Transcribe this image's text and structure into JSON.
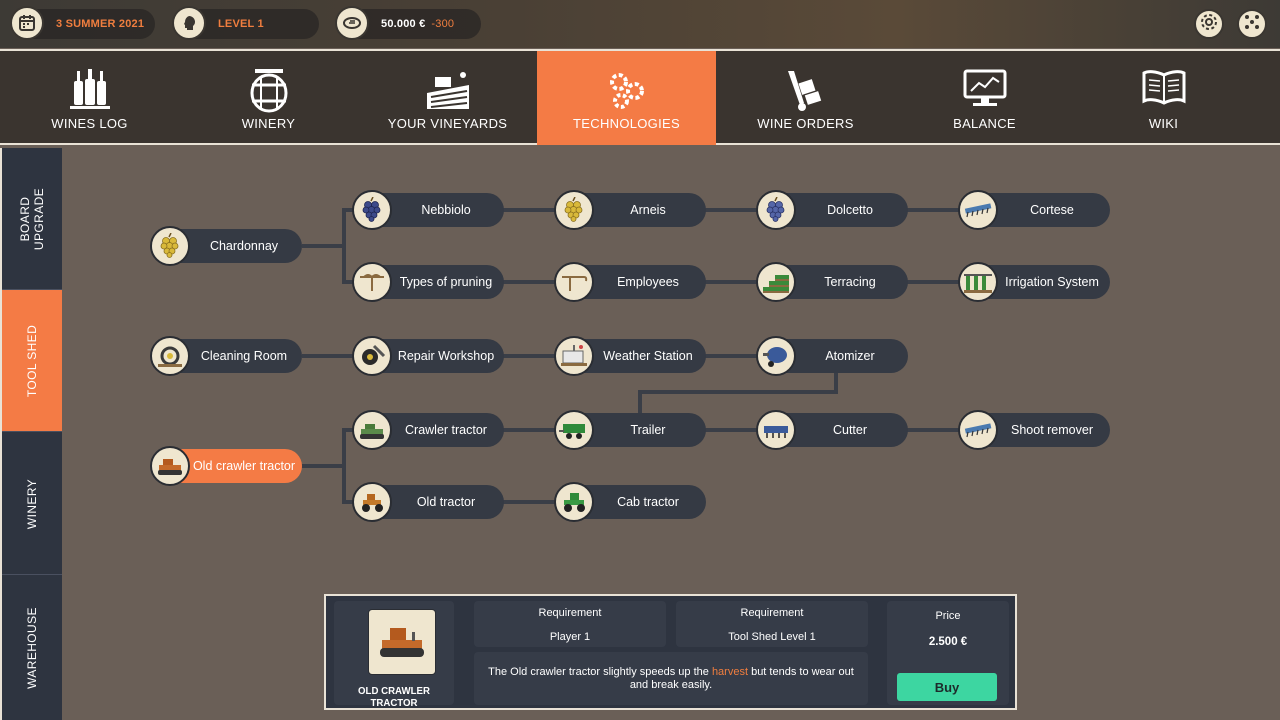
{
  "status": {
    "date": "3 SUMMER 2021",
    "level": "LEVEL 1",
    "money": "50.000 €",
    "money_delta": "-300"
  },
  "nav": [
    {
      "label": "WINES LOG",
      "icon": "wine-bottles-icon"
    },
    {
      "label": "WINERY",
      "icon": "barrel-icon"
    },
    {
      "label": "YOUR VINEYARDS",
      "icon": "vineyard-icon"
    },
    {
      "label": "TECHNOLOGIES",
      "icon": "gears-icon",
      "active": true
    },
    {
      "label": "WINE ORDERS",
      "icon": "hand-truck-icon"
    },
    {
      "label": "BALANCE",
      "icon": "monitor-chart-icon"
    },
    {
      "label": "WIKI",
      "icon": "book-icon"
    }
  ],
  "side_tabs": [
    {
      "label": "BOARD UPGRADE"
    },
    {
      "label": "TOOL SHED",
      "active": true
    },
    {
      "label": "WINERY"
    },
    {
      "label": "WAREHOUSE"
    }
  ],
  "tree": {
    "chardonnay": "Chardonnay",
    "nebbiolo": "Nebbiolo",
    "arneis": "Arneis",
    "dolcetto": "Dolcetto",
    "cortese": "Cortese",
    "pruning": "Types of pruning",
    "employees": "Employees",
    "terracing": "Terracing",
    "irrigation": "Irrigation System",
    "cleaning": "Cleaning Room",
    "repair": "Repair Workshop",
    "weather": "Weather Station",
    "atomizer": "Atomizer",
    "old_crawler": "Old crawler tractor",
    "crawler": "Crawler tractor",
    "trailer": "Trailer",
    "cutter": "Cutter",
    "shoot": "Shoot remover",
    "old_tractor": "Old tractor",
    "cab_tractor": "Cab tractor"
  },
  "detail": {
    "name": "OLD CRAWLER TRACTOR",
    "req1_title": "Requirement",
    "req1_value": "Player 1",
    "req2_title": "Requirement",
    "req2_value": "Tool Shed Level 1",
    "desc_before": "The Old crawler tractor slightly speeds up the ",
    "desc_highlight": "harvest",
    "desc_after": " but tends to wear out and break easily.",
    "price_title": "Price",
    "price_value": "2.500 €",
    "buy_label": "Buy"
  },
  "colors": {
    "accent": "#f47b45",
    "buy": "#3dd6a1",
    "panel": "#2e3440"
  }
}
